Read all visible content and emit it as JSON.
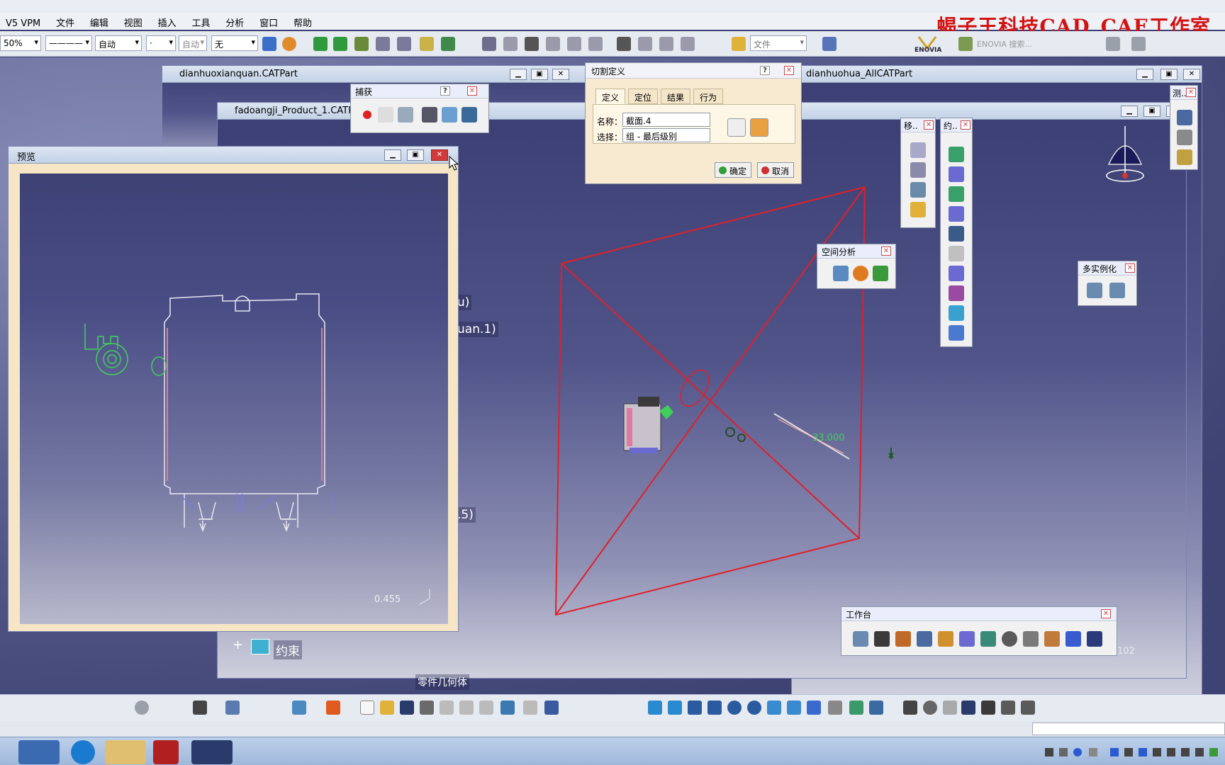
{
  "app": {
    "title_left": "V5 VPM",
    "watermark": "蝎子王科技CAD_CAE工作室"
  },
  "menu": [
    "文件",
    "编辑",
    "视图",
    "插入",
    "工具",
    "分析",
    "窗口",
    "帮助"
  ],
  "toolbar": {
    "zoom_value": "50%",
    "line_style": "————",
    "auto_label": "自动",
    "dot_label": "·",
    "auto2_label": "自动",
    "none_label": "无",
    "file_label": "文件",
    "enovia_label": "ENOVIA",
    "enovia_search": "ENOVIA 搜索..."
  },
  "windows": {
    "dianhuoxianquan": "dianhuoxianquan.CATPart",
    "fadoangji": "fadoangji_Product_1.CATPro",
    "dianhuohua": "dianhuohua_AllCATPart"
  },
  "capture_panel": {
    "title": "捕获"
  },
  "cut_definition": {
    "title": "切割定义",
    "tabs": [
      "定义",
      "定位",
      "结果",
      "行为"
    ],
    "name_label": "名称：",
    "name_value": "截面.4",
    "select_label": "选择：",
    "select_value": "组 - 最后级别",
    "ok_label": "确定",
    "cancel_label": "取消"
  },
  "preview": {
    "title": "预览",
    "scale": "0.455"
  },
  "panels": {
    "move": "移..",
    "constraint": "约..",
    "measure": "测..",
    "space_analysis": "空间分析",
    "multi_instance": "多实例化",
    "workbench": "工作台"
  },
  "tree": {
    "lbl_u": "u)",
    "lbl_uan": "uan.1)",
    "lbl_5": ".5)",
    "constraint": "约束",
    "mat_cut": "零件几何体"
  },
  "viewport": {
    "dim_value": "33.000",
    "scale_right": "102"
  },
  "colors": {
    "accent_red": "#d31212",
    "plane_red": "#e0202a",
    "wire_green": "#3fd05a",
    "wire_pink": "#e07aa0",
    "wire_white": "#e8e8f2"
  }
}
